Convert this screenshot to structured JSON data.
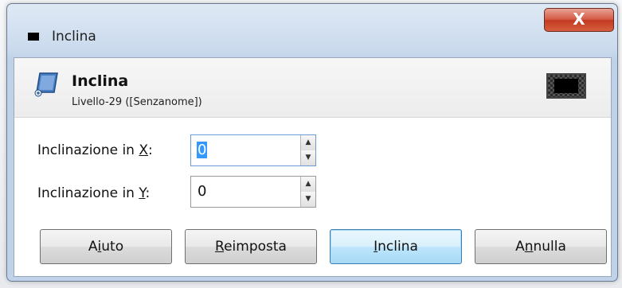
{
  "window": {
    "title": "Inclina",
    "close_glyph": "X"
  },
  "header": {
    "title": "Inclina",
    "subtitle": "Livello-29 ([Senzanome])",
    "icon": "shear-tool-icon"
  },
  "fields": {
    "x": {
      "label_pre": "Inclinazione in ",
      "label_key": "X",
      "label_post": ":",
      "value": "0"
    },
    "y": {
      "label_pre": "Inclinazione in ",
      "label_key": "Y",
      "label_post": ":",
      "value": "0"
    }
  },
  "buttons": {
    "help": {
      "pre": "A",
      "key": "i",
      "post": "uto"
    },
    "reset": {
      "pre": "",
      "key": "R",
      "post": "eimposta"
    },
    "apply": {
      "pre": "",
      "key": "I",
      "post": "nclina"
    },
    "cancel": {
      "pre": "A",
      "key": "n",
      "post": "nulla"
    }
  },
  "colors": {
    "selection": "#3399ff",
    "close": "#c23a22",
    "focus_border": "#3c7fb1"
  }
}
